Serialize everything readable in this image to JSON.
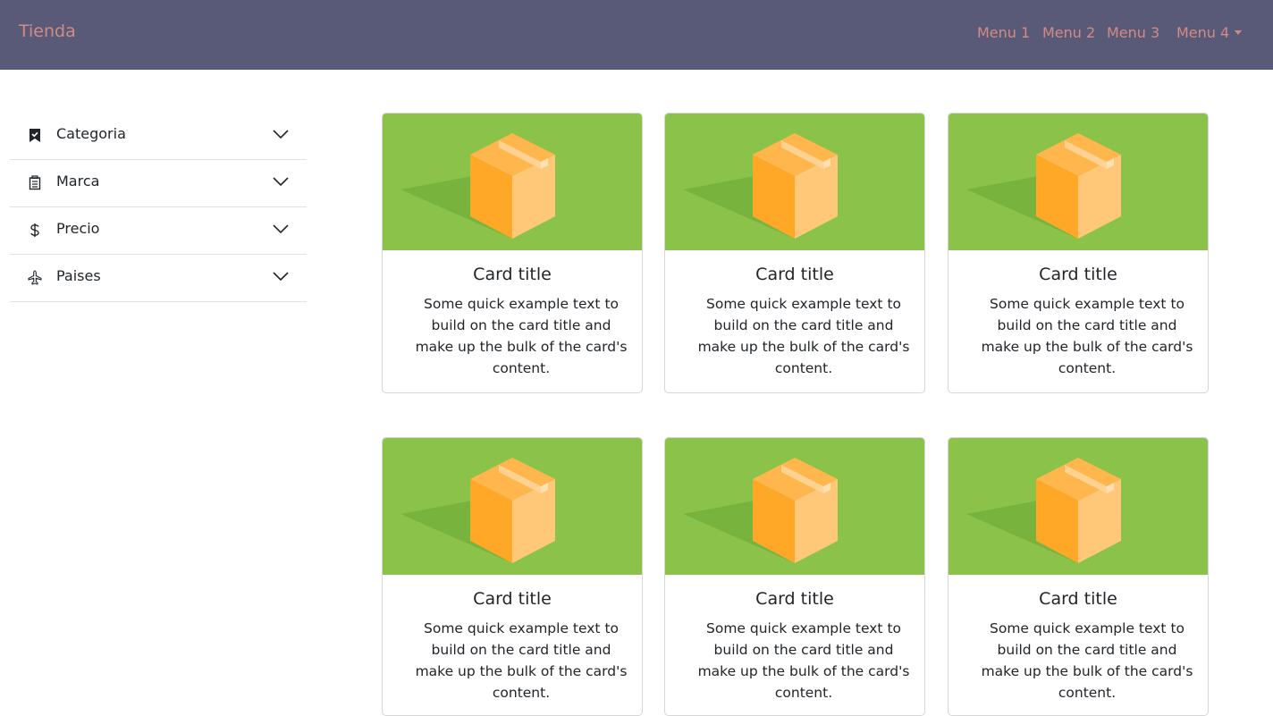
{
  "navbar": {
    "brand": "Tienda",
    "menus": [
      "Menu 1",
      "Menu 2",
      "Menu 3",
      "Menu 4"
    ]
  },
  "sidebar": {
    "items": [
      {
        "label": "Categoria",
        "icon": "bookmark-check-icon"
      },
      {
        "label": "Marca",
        "icon": "building-icon"
      },
      {
        "label": "Precio",
        "icon": "dollar-icon"
      },
      {
        "label": "Paises",
        "icon": "airplane-icon"
      }
    ]
  },
  "cards": [
    {
      "title": "Card title",
      "text": "Some quick example text to build on the card title and make up the bulk of the card's content."
    },
    {
      "title": "Card title",
      "text": "Some quick example text to build on the card title and make up the bulk of the card's content."
    },
    {
      "title": "Card title",
      "text": "Some quick example text to build on the card title and make up the bulk of the card's content."
    },
    {
      "title": "Card title",
      "text": "Some quick example text to build on the card title and make up the bulk of the card's content."
    },
    {
      "title": "Card title",
      "text": "Some quick example text to build on the card title and make up the bulk of the card's content."
    },
    {
      "title": "Card title",
      "text": "Some quick example text to build on the card title and make up the bulk of the card's content."
    }
  ],
  "colors": {
    "navbar_bg": "#585a77",
    "nav_text": "#d48a86",
    "card_image_bg": "#8bc34a",
    "box": "#ffb74d"
  }
}
